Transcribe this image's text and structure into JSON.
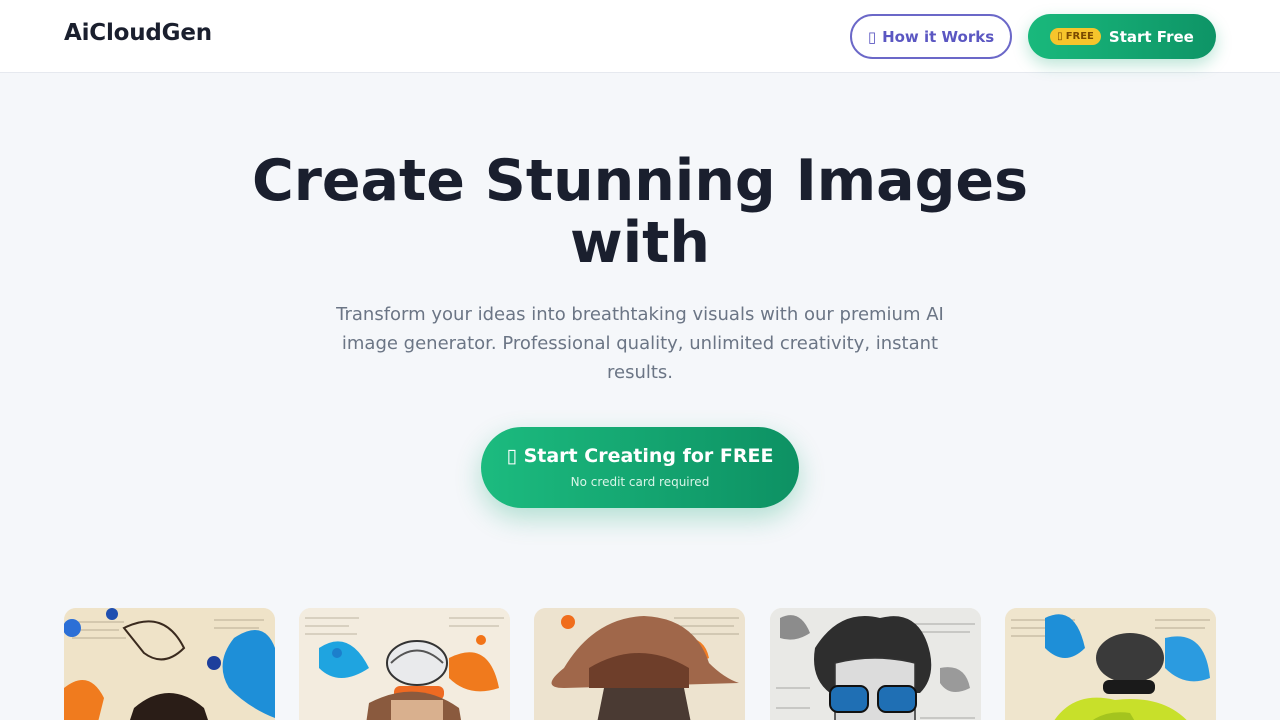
{
  "nav": {
    "brand": "AiCloudGen",
    "how_it_works": {
      "icon_glyph": "▯",
      "label": "How it Works"
    },
    "start_free": {
      "badge_icon_glyph": "▯",
      "badge_label": "FREE",
      "label": "Start Free"
    }
  },
  "hero": {
    "title": "Create Stunning Images with",
    "subtitle": "Transform your ideas into breathtaking visuals with our premium AI image generator. Professional quality, unlimited creativity, instant results.",
    "cta": {
      "icon_glyph": "▯",
      "label": "Start Creating for FREE",
      "note": "No credit card required"
    }
  },
  "gallery": {
    "items": [
      {
        "name": "gallery-image-dancer"
      },
      {
        "name": "gallery-image-cyclist"
      },
      {
        "name": "gallery-image-cowboy"
      },
      {
        "name": "gallery-image-sunglasses-man"
      },
      {
        "name": "gallery-image-cyclist-green"
      }
    ]
  },
  "colors": {
    "brand_green": "#14a872",
    "accent_purple": "#5b57c2",
    "badge_yellow": "#f6c52c"
  }
}
